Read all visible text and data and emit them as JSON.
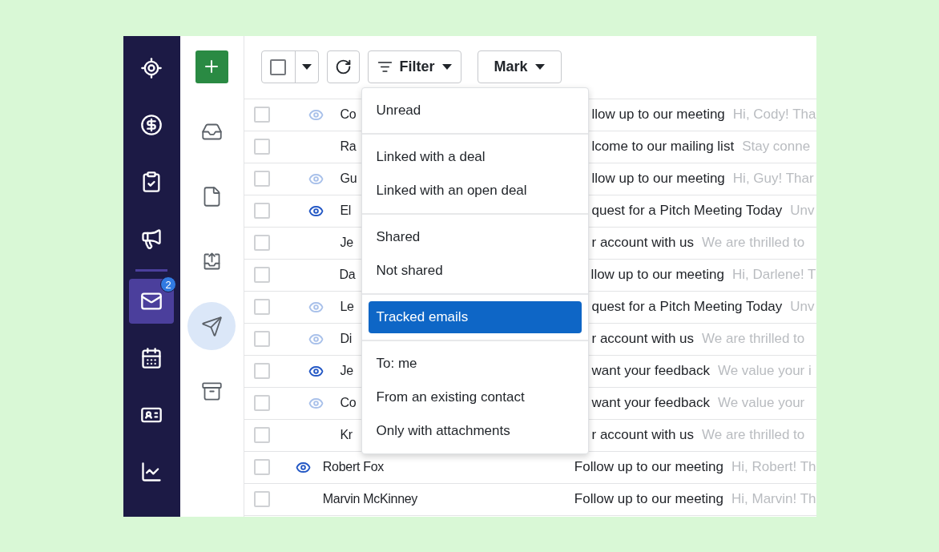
{
  "nav": {
    "top_items": [
      {
        "kind": "target",
        "selected": false
      },
      {
        "kind": "dollar",
        "selected": false
      },
      {
        "kind": "tasks",
        "selected": false
      },
      {
        "kind": "megaphone",
        "selected": false
      }
    ],
    "bottom_items": [
      {
        "kind": "mail",
        "selected": true,
        "badge": "2"
      },
      {
        "kind": "calendar",
        "selected": false
      },
      {
        "kind": "contacts",
        "selected": false
      },
      {
        "kind": "chart",
        "selected": false
      }
    ]
  },
  "folders": [
    {
      "kind": "inbox",
      "selected": false
    },
    {
      "kind": "draft",
      "selected": false
    },
    {
      "kind": "outbox",
      "selected": false
    },
    {
      "kind": "sent",
      "selected": true
    },
    {
      "kind": "archive",
      "selected": false
    }
  ],
  "toolbar": {
    "select_all": {
      "checked": false
    },
    "filter_label": "Filter",
    "mark_label": "Mark"
  },
  "filter_menu": {
    "groups": [
      [
        {
          "label": "Unread",
          "selected": false
        }
      ],
      [
        {
          "label": "Linked with a deal",
          "selected": false
        },
        {
          "label": "Linked with an open deal",
          "selected": false
        }
      ],
      [
        {
          "label": "Shared",
          "selected": false
        },
        {
          "label": "Not shared",
          "selected": false
        }
      ],
      [
        {
          "label": "Tracked emails",
          "selected": true
        }
      ],
      [
        {
          "label": "To: me",
          "selected": false
        },
        {
          "label": "From an existing contact",
          "selected": false
        },
        {
          "label": "Only with attachments",
          "selected": false
        }
      ]
    ]
  },
  "emails": [
    {
      "checked": false,
      "tracked": true,
      "opened": false,
      "name": "Co",
      "subject": "llow up to our meeting",
      "preview": "Hi, Cody! Tha"
    },
    {
      "checked": false,
      "tracked": false,
      "name": "Ra",
      "subject": "lcome to our mailing list",
      "preview": "Stay conne"
    },
    {
      "checked": false,
      "tracked": true,
      "opened": false,
      "name": "Gu",
      "subject": "llow up to our meeting",
      "preview": "Hi, Guy! Thar"
    },
    {
      "checked": false,
      "tracked": true,
      "opened": true,
      "name": "El",
      "subject": "quest for a Pitch Meeting Today",
      "preview": "Unv"
    },
    {
      "checked": false,
      "tracked": false,
      "name": "Je",
      "subject": "r account with us",
      "preview": "We are thrilled to"
    },
    {
      "checked": false,
      "tracked": false,
      "name": "Da",
      "subject": "llow up to our meeting",
      "preview": "Hi, Darlene! T"
    },
    {
      "checked": false,
      "tracked": true,
      "opened": false,
      "name": "Le",
      "subject": "quest for a Pitch Meeting Today",
      "preview": "Unv"
    },
    {
      "checked": false,
      "tracked": true,
      "opened": false,
      "name": "Di",
      "subject": "r account with us",
      "preview": "We are thrilled to"
    },
    {
      "checked": false,
      "tracked": true,
      "opened": true,
      "name": "Je",
      "subject": "want your feedback",
      "preview": "We value your i"
    },
    {
      "checked": false,
      "tracked": true,
      "opened": false,
      "name": "Co",
      "subject": "want your feedback",
      "preview": "We value your"
    },
    {
      "checked": false,
      "tracked": false,
      "name": "Kr",
      "subject": "r account with us",
      "preview": "We are thrilled to"
    },
    {
      "checked": false,
      "tracked": true,
      "opened": true,
      "name": "Robert Fox",
      "subject": "Follow up to our meeting",
      "preview": "Hi, Robert! Th"
    },
    {
      "checked": false,
      "tracked": false,
      "name": "Marvin McKinney",
      "subject": "Follow up to our meeting",
      "preview": "Hi, Marvin! Th"
    }
  ]
}
